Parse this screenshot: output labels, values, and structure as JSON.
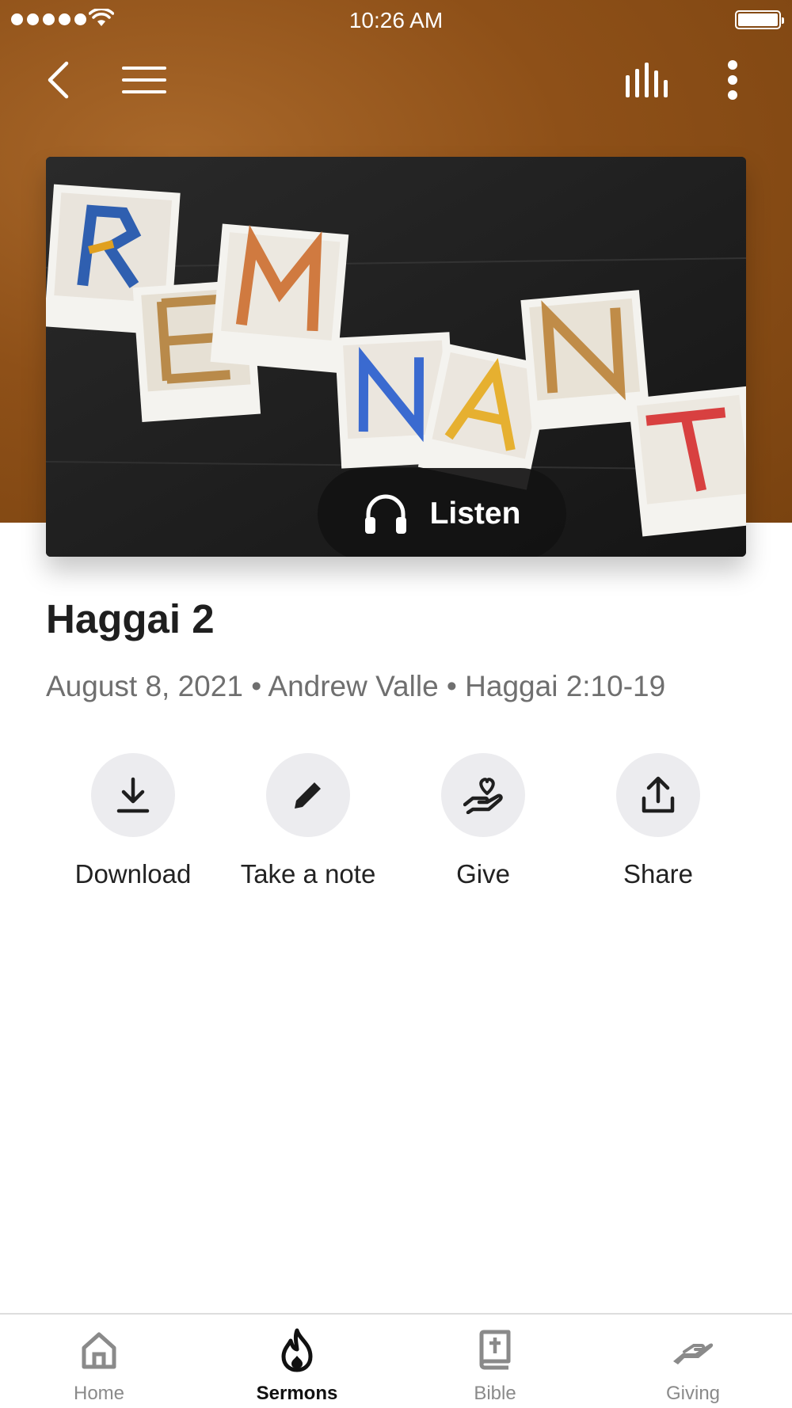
{
  "status_bar": {
    "time": "10:26 AM"
  },
  "header": {
    "back_icon": "chevron-left-icon",
    "menu_icon": "hamburger-menu-icon",
    "audio_icon": "equalizer-icon",
    "more_icon": "more-vertical-icon"
  },
  "artwork": {
    "listen_label": "Listen",
    "listen_icon": "headphones-icon"
  },
  "sermon": {
    "title": "Haggai 2",
    "meta": "August 8, 2021 • Andrew Valle • Haggai 2:10-19"
  },
  "actions": [
    {
      "label": "Download",
      "icon": "download-icon"
    },
    {
      "label": "Take a note",
      "icon": "pencil-icon"
    },
    {
      "label": "Give",
      "icon": "hand-heart-icon"
    },
    {
      "label": "Share",
      "icon": "share-icon"
    }
  ],
  "tabs": [
    {
      "label": "Home",
      "icon": "home-icon",
      "active": false
    },
    {
      "label": "Sermons",
      "icon": "flame-icon",
      "active": true
    },
    {
      "label": "Bible",
      "icon": "bible-icon",
      "active": false
    },
    {
      "label": "Giving",
      "icon": "giving-icon",
      "active": false
    }
  ],
  "colors": {
    "header_brown": "#8e5018",
    "accent_dark": "#121212",
    "inactive_tab": "#8a8a8a"
  }
}
